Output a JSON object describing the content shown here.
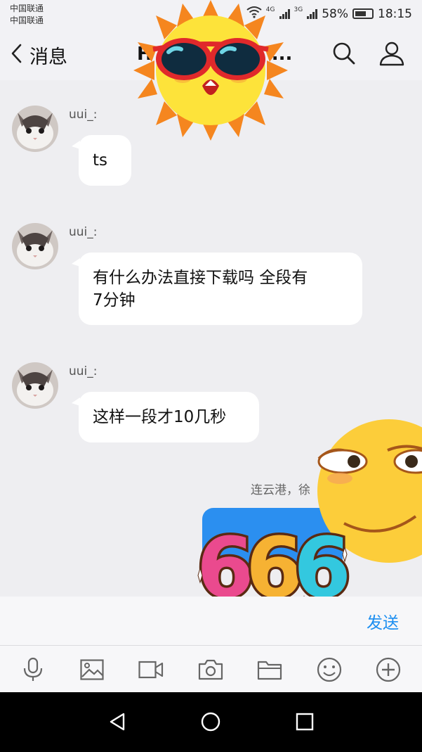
{
  "status_bar": {
    "carrier_1": "中国联通",
    "carrier_2": "中国联通",
    "network_1": "4G",
    "network_2": "3G",
    "battery": "58%",
    "time": "18:15"
  },
  "header": {
    "back_label": "消息",
    "title": "H",
    "title_suffix": "..."
  },
  "messages": [
    {
      "sender": "uui_:",
      "text": "ts"
    },
    {
      "sender": "uui_:",
      "text_line_1": "有什么办法直接下载吗 全段有",
      "text_line_2": "7分钟"
    },
    {
      "sender": "uui_:",
      "text": "这样一段才10几秒"
    }
  ],
  "location_note": "连云港，徐",
  "input": {
    "placeholder": "",
    "send_label": "发送"
  },
  "toolbar_icons": [
    "mic-icon",
    "image-icon",
    "video-icon",
    "camera-icon",
    "folder-icon",
    "emoji-icon",
    "plus-icon"
  ],
  "stickers": {
    "bottom_right_text": "666"
  },
  "colors": {
    "accent": "#1c8ef0",
    "background": "#eeeef1",
    "bubble": "#ffffff"
  }
}
